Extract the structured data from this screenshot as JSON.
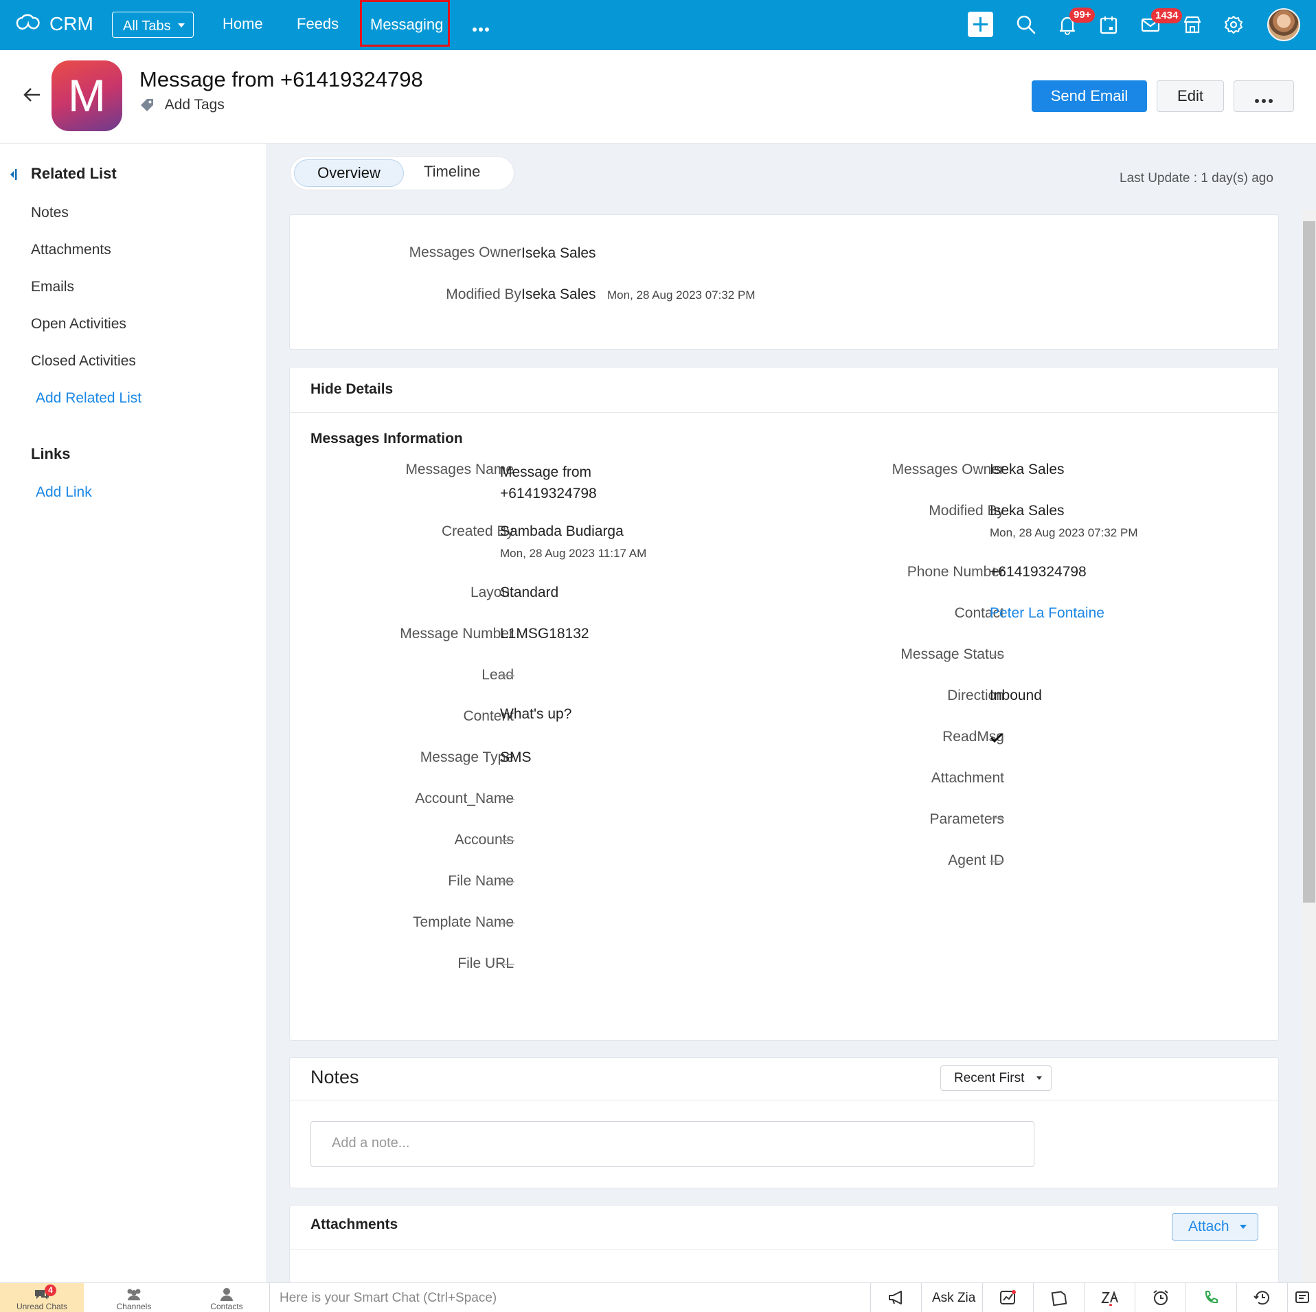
{
  "topbar": {
    "app_name": "CRM",
    "all_tabs": "All Tabs",
    "nav": [
      "Home",
      "Feeds",
      "Messaging"
    ],
    "notifications_badge": "99+",
    "mail_badge": "1434",
    "accent": "#0698d6",
    "highlight_color": "#e0141b"
  },
  "header": {
    "avatar_letter": "M",
    "title": "Message from +61419324798",
    "add_tags": "Add Tags",
    "send_email": "Send Email",
    "edit": "Edit"
  },
  "sidebar": {
    "related_title": "Related List",
    "related_items": [
      "Notes",
      "Attachments",
      "Emails",
      "Open Activities",
      "Closed Activities"
    ],
    "add_related": "Add Related List",
    "links_title": "Links",
    "add_link": "Add Link"
  },
  "tabs": {
    "overview": "Overview",
    "timeline": "Timeline"
  },
  "last_update": "Last Update : 1 day(s) ago",
  "summary": {
    "owner_label": "Messages Owner",
    "owner_value": "Iseka Sales",
    "modified_label": "Modified By",
    "modified_value": "Iseka Sales",
    "modified_time": "Mon, 28 Aug 2023 07:32 PM"
  },
  "details": {
    "hide": "Hide Details",
    "section": "Messages Information",
    "dash": "—",
    "left": [
      {
        "label": "Messages Name",
        "value": "Message from",
        "value2": "+61419324798"
      },
      {
        "label": "Created By",
        "value": "Sambada Budiarga",
        "sub": "Mon, 28 Aug 2023 11:17 AM"
      },
      {
        "label": "Layout",
        "value": "Standard"
      },
      {
        "label": "Message Number",
        "value": "L1MSG18132"
      },
      {
        "label": "Lead"
      },
      {
        "label": "Content",
        "value": "What's up?"
      },
      {
        "label": "Message Type",
        "value": "SMS"
      },
      {
        "label": "Account_Name"
      },
      {
        "label": "Accounts"
      },
      {
        "label": "File Name"
      },
      {
        "label": "Template Name"
      },
      {
        "label": "File URL"
      }
    ],
    "right": [
      {
        "label": "Messages Owner",
        "value": "Iseka Sales"
      },
      {
        "label": "Modified By",
        "value": "Iseka Sales",
        "sub": "Mon, 28 Aug 2023 07:32 PM"
      },
      {
        "label": "Phone Number",
        "value": "+61419324798"
      },
      {
        "label": "Contact",
        "value": "Peter La Fontaine"
      },
      {
        "label": "Message Status"
      },
      {
        "label": "Direction",
        "value": "Inbound"
      },
      {
        "label": "ReadMsg",
        "value": "checked"
      },
      {
        "label": "Attachment"
      },
      {
        "label": "Parameters"
      },
      {
        "label": "Agent ID"
      }
    ]
  },
  "notes": {
    "title": "Notes",
    "sort": "Recent First",
    "placeholder": "Add a note..."
  },
  "attachments": {
    "title": "Attachments",
    "attach": "Attach"
  },
  "bottombar": {
    "unread_chats": "Unread Chats",
    "unread_badge": "4",
    "channels": "Channels",
    "contacts": "Contacts",
    "smart_chat": "Here is your Smart Chat (Ctrl+Space)",
    "ask_zia": "Ask Zia"
  }
}
